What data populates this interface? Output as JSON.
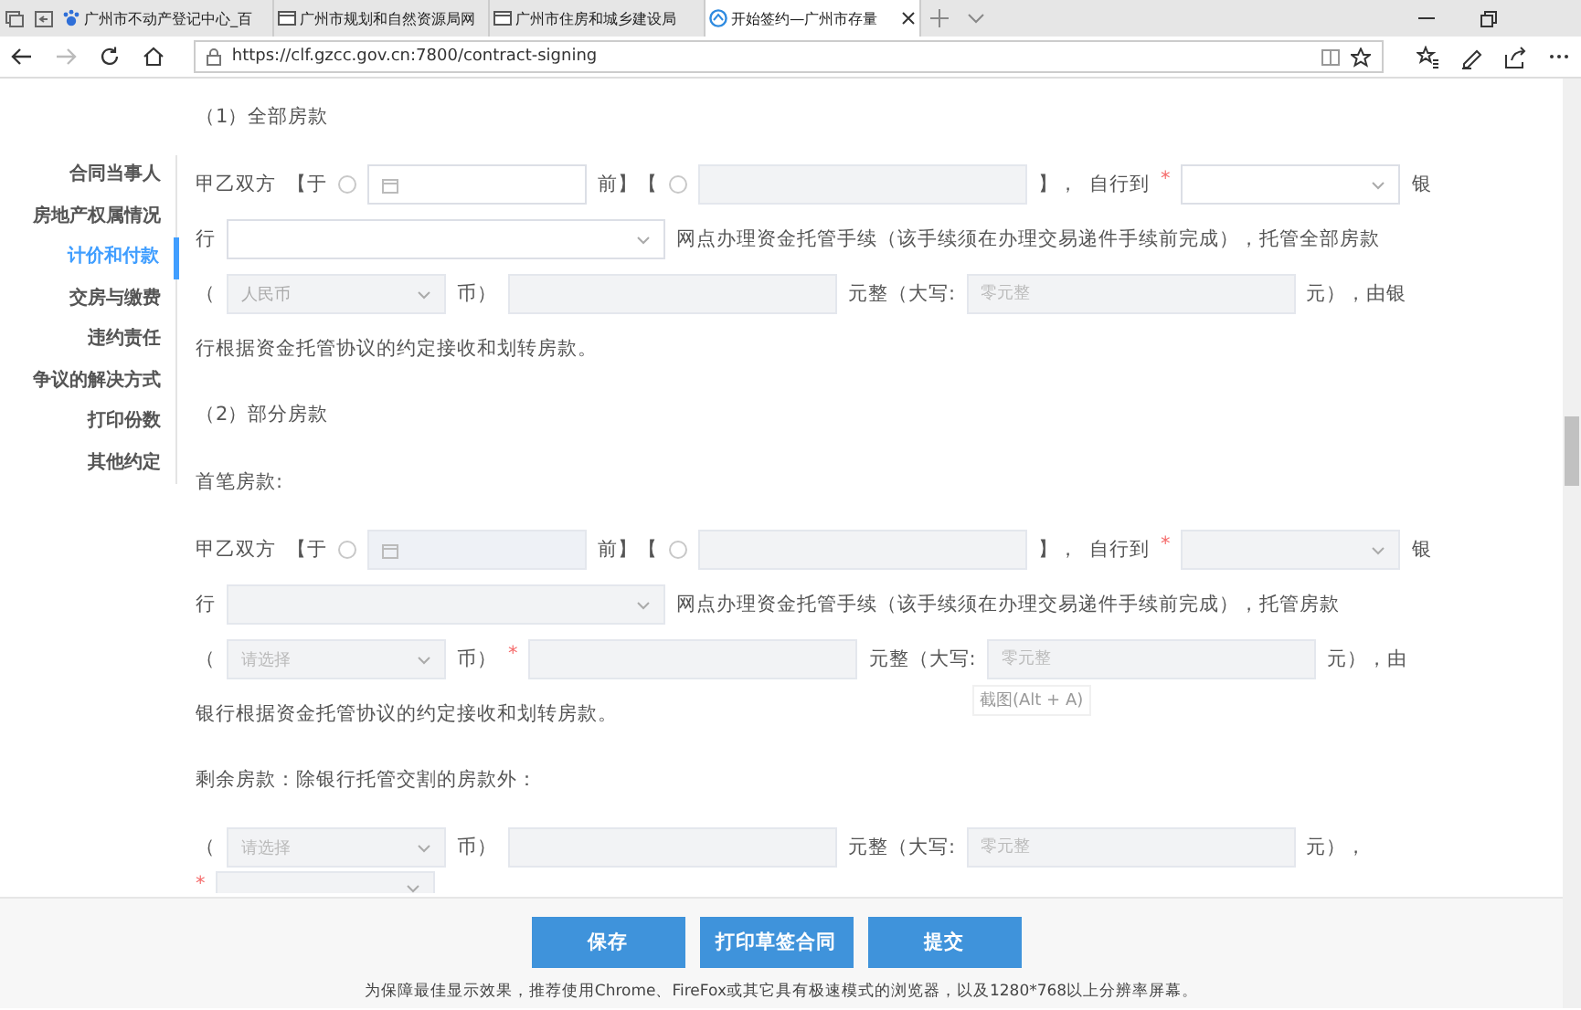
{
  "browser": {
    "tabs": [
      {
        "title": "广州市不动产登记中心_百",
        "selected": false
      },
      {
        "title": "广州市规划和自然资源局网",
        "selected": false
      },
      {
        "title": "广州市住房和城乡建设局",
        "selected": false
      },
      {
        "title": "开始签约—广州市存量",
        "selected": true
      }
    ],
    "url": "https://clf.gzcc.gov.cn:7800/contract-signing"
  },
  "sidebar": {
    "items": [
      {
        "label": "合同当事人",
        "selected": false
      },
      {
        "label": "房地产权属情况",
        "selected": false
      },
      {
        "label": "计价和付款",
        "selected": true
      },
      {
        "label": "交房与缴费",
        "selected": false
      },
      {
        "label": "违约责任",
        "selected": false
      },
      {
        "label": "争议的解决方式",
        "selected": false
      },
      {
        "label": "打印份数",
        "selected": false
      },
      {
        "label": "其他约定",
        "selected": false
      }
    ]
  },
  "form": {
    "blocks": [
      {
        "kind": "heading",
        "text": "（1）全部房款"
      },
      {
        "kind": "row",
        "parts": [
          {
            "kind": "text",
            "text": "甲乙双方"
          },
          {
            "kind": "text",
            "text": "【于"
          },
          {
            "kind": "radio",
            "checked": false
          },
          {
            "kind": "date",
            "disabled": false
          },
          {
            "kind": "text",
            "text": "前】【"
          },
          {
            "kind": "radio",
            "checked": false
          },
          {
            "kind": "input",
            "disabled": true
          },
          {
            "kind": "text",
            "text": "】，"
          },
          {
            "kind": "text",
            "text": "自行到"
          },
          {
            "kind": "required",
            "text": "*"
          },
          {
            "kind": "select",
            "disabled": false
          },
          {
            "kind": "text",
            "text": "银"
          }
        ]
      },
      {
        "kind": "row",
        "parts": [
          {
            "kind": "text",
            "text": "行"
          },
          {
            "kind": "branch",
            "disabled": false
          },
          {
            "kind": "text",
            "text": "网点办理资金托管手续（该手续须在办理交易递件手续前完成），托管全部房款"
          }
        ]
      },
      {
        "kind": "row",
        "parts": [
          {
            "kind": "text",
            "text": "（"
          },
          {
            "kind": "select",
            "disabled": true,
            "value": "人民币"
          },
          {
            "kind": "text",
            "text": "币）"
          },
          {
            "kind": "input",
            "disabled": true
          },
          {
            "kind": "text",
            "text": "元整（大写:"
          },
          {
            "kind": "input",
            "disabled": true,
            "placeholder": "零元整"
          },
          {
            "kind": "text",
            "text": "元），由银"
          }
        ]
      },
      {
        "kind": "text",
        "text": "行根据资金托管协议的约定接收和划转房款。"
      },
      {
        "kind": "heading",
        "text": "（2）部分房款"
      },
      {
        "kind": "label",
        "text": "首笔房款:"
      },
      {
        "kind": "row",
        "parts": [
          {
            "kind": "text",
            "text": "甲乙双方"
          },
          {
            "kind": "text",
            "text": "【于"
          },
          {
            "kind": "radio",
            "checked": false
          },
          {
            "kind": "date",
            "disabled": true
          },
          {
            "kind": "text",
            "text": "前】【"
          },
          {
            "kind": "radio",
            "checked": false
          },
          {
            "kind": "input",
            "disabled": true
          },
          {
            "kind": "text",
            "text": "】，"
          },
          {
            "kind": "text",
            "text": "自行到"
          },
          {
            "kind": "required",
            "text": "*"
          },
          {
            "kind": "select",
            "disabled": true
          },
          {
            "kind": "text",
            "text": "银"
          }
        ]
      },
      {
        "kind": "row",
        "parts": [
          {
            "kind": "text",
            "text": "行"
          },
          {
            "kind": "branch",
            "disabled": true
          },
          {
            "kind": "text",
            "text": "网点办理资金托管手续（该手续须在办理交易递件手续前完成），托管房款"
          }
        ]
      },
      {
        "kind": "row",
        "parts": [
          {
            "kind": "text",
            "text": "（"
          },
          {
            "kind": "select",
            "disabled": true,
            "placeholder": "请选择"
          },
          {
            "kind": "text",
            "text": "币）"
          },
          {
            "kind": "required",
            "text": "*"
          },
          {
            "kind": "input",
            "disabled": true
          },
          {
            "kind": "text",
            "text": "元整（大写:"
          },
          {
            "kind": "input",
            "disabled": true,
            "placeholder": "零元整"
          },
          {
            "kind": "text",
            "text": "元），由"
          }
        ]
      },
      {
        "kind": "text",
        "text": "银行根据资金托管协议的约定接收和划转房款。"
      },
      {
        "kind": "label",
        "text": "剩余房款：除银行托管交割的房款外："
      },
      {
        "kind": "row",
        "parts": [
          {
            "kind": "text",
            "text": "（"
          },
          {
            "kind": "select",
            "disabled": true,
            "placeholder": "请选择"
          },
          {
            "kind": "text",
            "text": "币）"
          },
          {
            "kind": "input",
            "disabled": true
          },
          {
            "kind": "text",
            "text": "元整（大写:"
          },
          {
            "kind": "input",
            "disabled": true,
            "placeholder": "零元整"
          },
          {
            "kind": "text",
            "text": "元），"
          }
        ]
      },
      {
        "kind": "row",
        "parts": [
          {
            "kind": "required",
            "text": "*"
          },
          {
            "kind": "select",
            "disabled": true
          }
        ]
      }
    ]
  },
  "tooltip": "截图(Alt + A)",
  "footer": {
    "buttons": [
      "保存",
      "打印草签合同",
      "提交"
    ],
    "note": "为保障最佳显示效果，推荐使用Chrome、FireFox或其它具有极速模式的浏览器，以及1280*768以上分辨率屏幕。"
  }
}
